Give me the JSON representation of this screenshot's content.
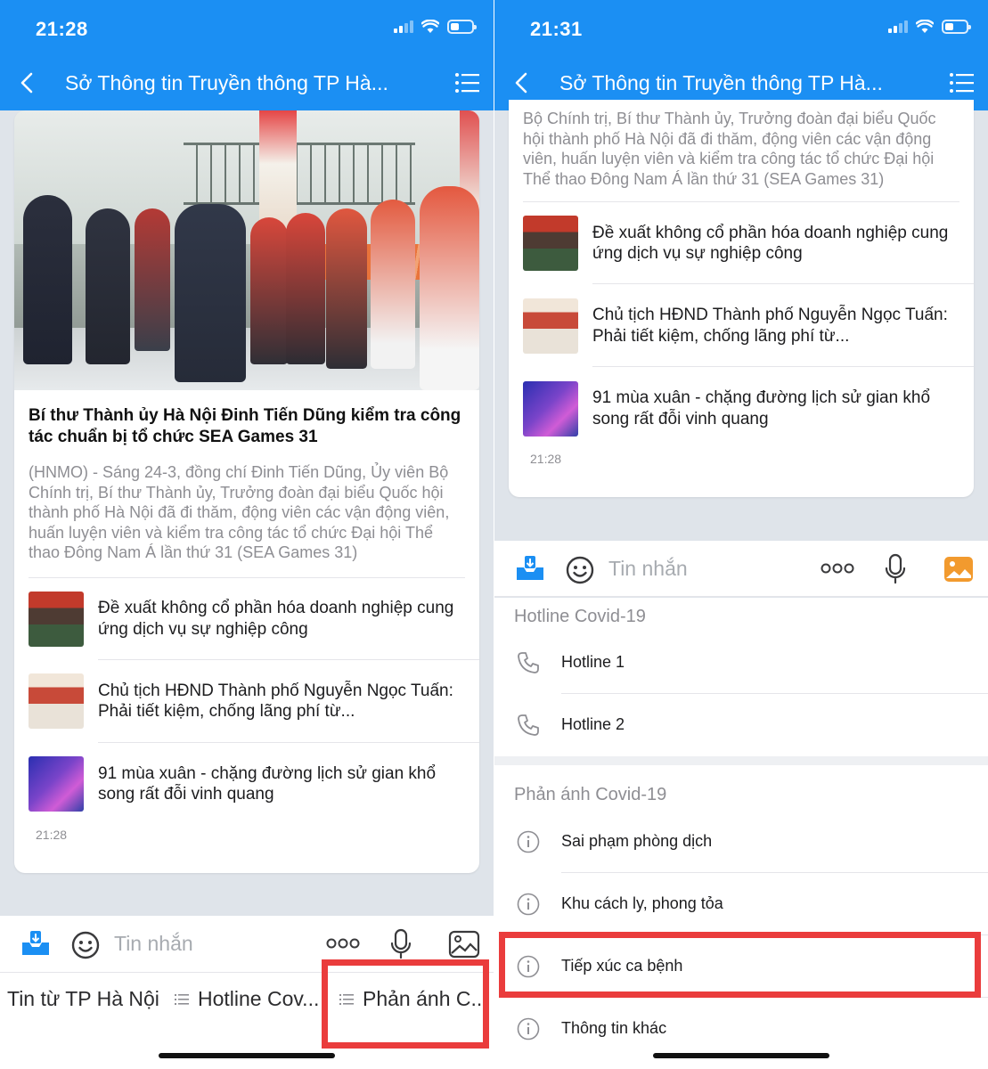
{
  "left": {
    "status": {
      "time": "21:28"
    },
    "nav": {
      "title": "Sở Thông tin Truyền thông TP Hà..."
    },
    "article": {
      "headline": "Bí thư Thành ủy Hà Nội Đinh Tiến Dũng kiểm tra công tác chuẩn bị tổ chức SEA Games 31",
      "summary": "(HNMO) - Sáng 24-3, đồng chí Đinh Tiến Dũng, Ủy viên Bộ Chính trị, Bí thư Thành ủy, Trưởng đoàn đại biểu Quốc hội thành phố Hà Nội đã đi thăm, động viên các vận động viên, huấn luyện viên và kiểm tra công tác tổ chức Đại hội Thể thao Đông Nam Á lần thứ 31 (SEA Games 31)",
      "items": [
        {
          "text": "Đề xuất không cổ phần hóa doanh nghiệp cung ứng dịch vụ sự nghiệp công"
        },
        {
          "text": "Chủ tịch HĐND Thành phố Nguyễn Ngọc Tuấn: Phải tiết kiệm, chống lãng phí từ..."
        },
        {
          "text": "91 mùa xuân - chặng đường lịch sử gian khổ song rất đỗi vinh quang"
        }
      ],
      "timestamp": "21:28"
    },
    "input": {
      "placeholder": "Tin nhắn"
    },
    "menu": {
      "tabs": [
        {
          "label": "Tin từ TP Hà Nội"
        },
        {
          "label": "Hotline Cov..."
        },
        {
          "label": "Phản ánh C..."
        }
      ]
    }
  },
  "right": {
    "status": {
      "time": "21:31"
    },
    "nav": {
      "title": "Sở Thông tin Truyền thông TP Hà..."
    },
    "article": {
      "summary_tail": "Bộ Chính trị, Bí thư Thành ủy, Trưởng đoàn đại biểu Quốc hội thành phố Hà Nội đã đi thăm, động viên các vận động viên, huấn luyện viên và kiểm tra công tác tổ chức Đại hội Thể thao Đông Nam Á lần thứ 31 (SEA Games 31)",
      "items": [
        {
          "text": "Đề xuất không cổ phần hóa doanh nghiệp cung ứng dịch vụ sự nghiệp công"
        },
        {
          "text": "Chủ tịch HĐND Thành phố Nguyễn Ngọc Tuấn: Phải tiết kiệm, chống lãng phí từ..."
        },
        {
          "text": "91 mùa xuân - chặng đường lịch sử gian khổ song rất đỗi vinh quang"
        }
      ],
      "timestamp": "21:28"
    },
    "input": {
      "placeholder": "Tin nhắn"
    },
    "sections": [
      {
        "header": "Hotline Covid-19",
        "icon": "phone-icon",
        "items": [
          {
            "label": "Hotline 1"
          },
          {
            "label": "Hotline 2"
          }
        ]
      },
      {
        "header": "Phản ánh Covid-19",
        "icon": "info-icon",
        "items": [
          {
            "label": "Sai phạm phòng dịch"
          },
          {
            "label": "Khu cách ly, phong tỏa"
          },
          {
            "label": "Tiếp xúc ca bệnh"
          },
          {
            "label": "Thông tin khác"
          }
        ]
      }
    ]
  },
  "colors": {
    "brand": "#1b8ff3",
    "highlight": "#ea3c3c",
    "muted": "#8e8e93"
  }
}
